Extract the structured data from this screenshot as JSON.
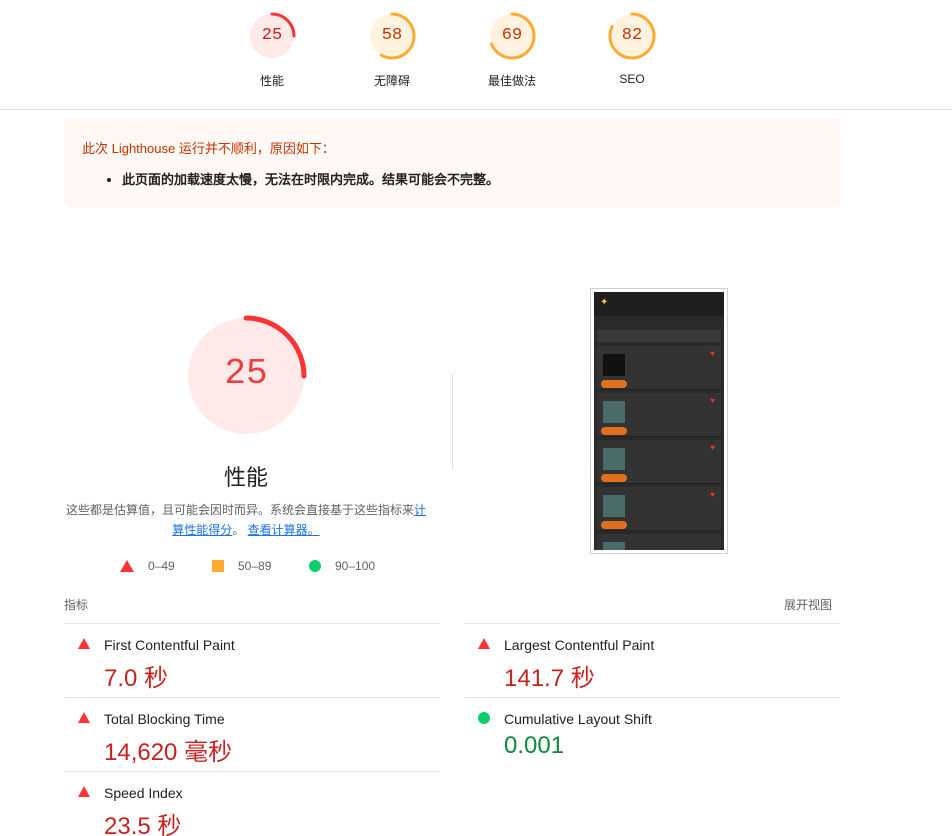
{
  "gauges": [
    {
      "score": "25",
      "label": "性能",
      "color": "#ff3333",
      "bg": "#ffe9e9",
      "fraction": 0.25
    },
    {
      "score": "58",
      "label": "无障碍",
      "color": "#ffaa33",
      "bg": "#fff3e0",
      "fraction": 0.58
    },
    {
      "score": "69",
      "label": "最佳做法",
      "color": "#ffaa33",
      "bg": "#fff3e0",
      "fraction": 0.69
    },
    {
      "score": "82",
      "label": "SEO",
      "color": "#ffaa33",
      "bg": "#fff3e0",
      "fraction": 0.82
    }
  ],
  "warning": {
    "title": "此次 Lighthouse 运行并不顺利，原因如下：",
    "item": "此页面的加载速度太慢，无法在时限内完成。结果可能会不完整。"
  },
  "performance": {
    "score": "25",
    "fraction": 0.25,
    "title": "性能",
    "desc_prefix": "这些都是估算值，且可能会因时而异。系统会直接基于这些指标来",
    "desc_link": "计算性能得分",
    "desc_sep": "。",
    "desc_link2": "查看计算器。"
  },
  "legend": [
    {
      "label": "0–49",
      "shape": "triangle",
      "color": "#ff3333"
    },
    {
      "label": "50–89",
      "shape": "square",
      "color": "#ffaa33"
    },
    {
      "label": "90–100",
      "shape": "circle",
      "color": "#0cce6b"
    }
  ],
  "metrics_header": {
    "left": "指标",
    "right": "展开视图"
  },
  "metrics": [
    {
      "name": "First Contentful Paint",
      "value": "7.0 秒",
      "status": "fail"
    },
    {
      "name": "Largest Contentful Paint",
      "value": "141.7 秒",
      "status": "fail"
    },
    {
      "name": "Total Blocking Time",
      "value": "14,620 毫秒",
      "status": "fail"
    },
    {
      "name": "Cumulative Layout Shift",
      "value": "0.001",
      "status": "pass"
    },
    {
      "name": "Speed Index",
      "value": "23.5 秒",
      "status": "fail"
    }
  ],
  "colors": {
    "fail": "#ff3333",
    "average": "#ffaa33",
    "pass": "#0cce6b"
  }
}
